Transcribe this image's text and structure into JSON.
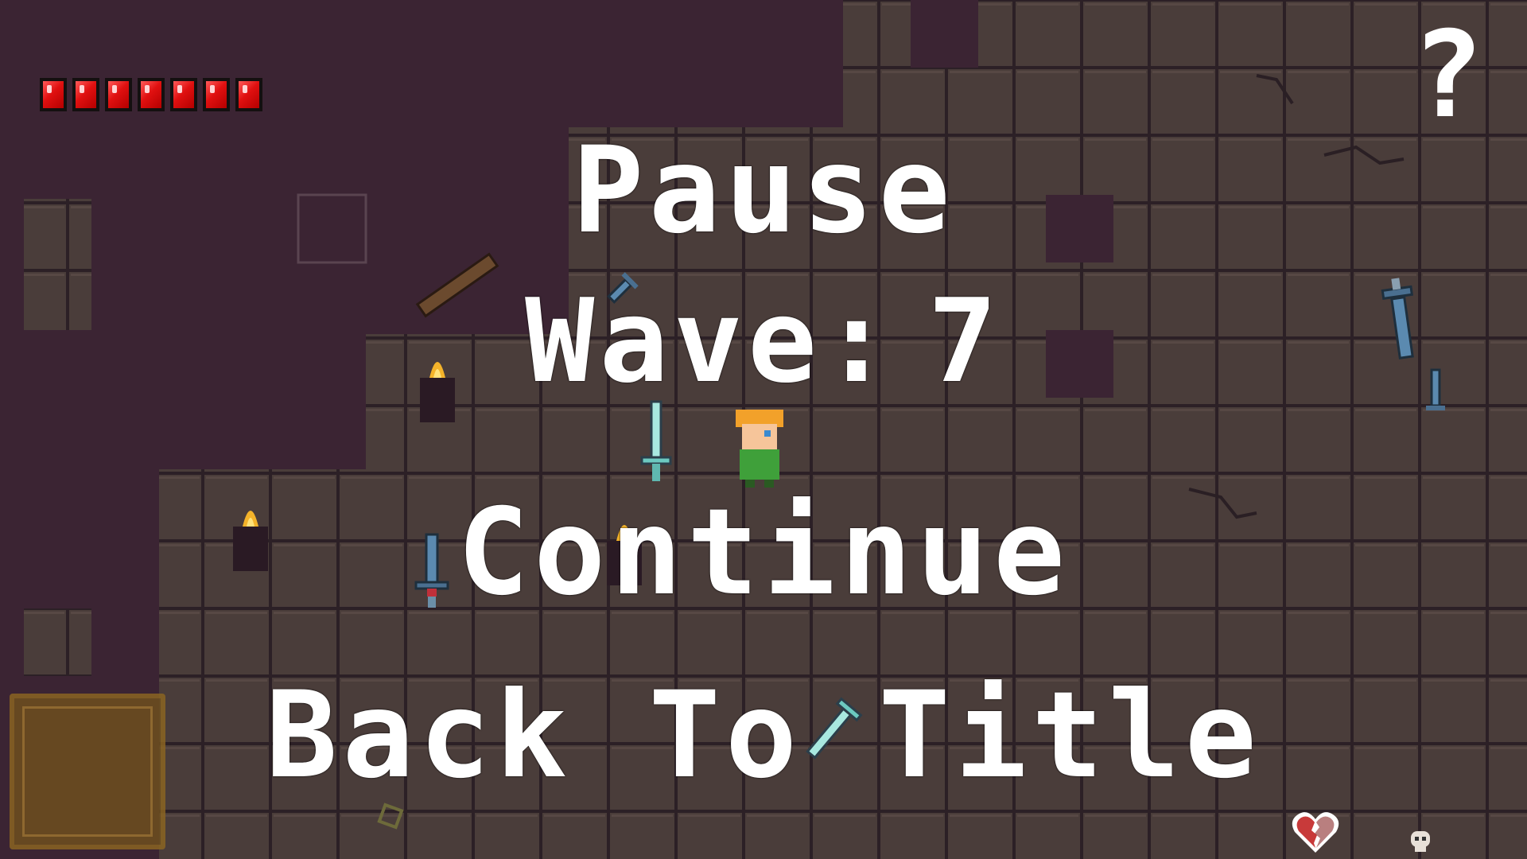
{
  "hud": {
    "health_pips": 7,
    "help_label": "?"
  },
  "pause_menu": {
    "title": "Pause",
    "wave_label": "Wave:",
    "wave_number": "7",
    "continue_label": "Continue",
    "back_label": "Back To Title"
  },
  "icons": {
    "player": "player-character-icon",
    "torch": "torch-icon",
    "sword": "sword-icon",
    "broken_heart": "broken-heart-icon",
    "skull": "skull-icon"
  },
  "colors": {
    "void": "#3b2433",
    "floor": "#4a3d3a",
    "grid": "#2c2026",
    "health": "#e01010",
    "text": "#ffffff",
    "inventory": "#8a6422"
  }
}
